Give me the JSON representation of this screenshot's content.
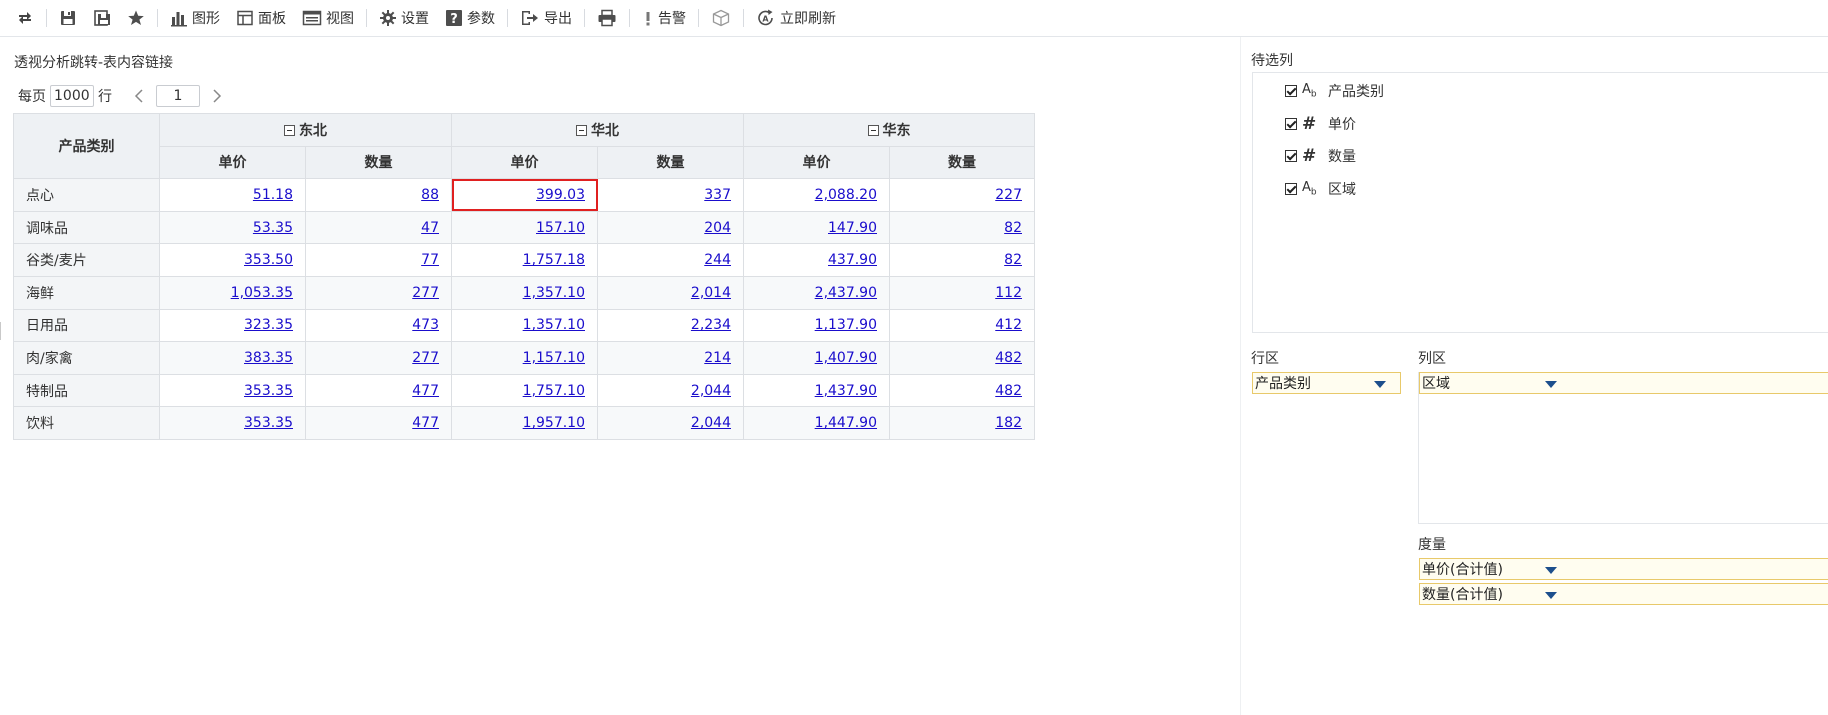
{
  "toolbar": {
    "items": [
      {
        "id": "refresh",
        "icon": "refresh-arrows-icon"
      },
      {
        "id": "save",
        "icon": "save-icon"
      },
      {
        "id": "save-as",
        "icon": "save-as-icon"
      },
      {
        "id": "favorite",
        "icon": "star-icon"
      },
      {
        "id": "chart",
        "icon": "bar-chart-icon",
        "label": "图形"
      },
      {
        "id": "panel",
        "icon": "panel-layout-icon",
        "label": "面板"
      },
      {
        "id": "view",
        "icon": "view-icon",
        "label": "视图"
      },
      {
        "id": "settings",
        "icon": "gear-icon",
        "label": "设置"
      },
      {
        "id": "params",
        "icon": "question-icon",
        "label": "参数"
      },
      {
        "id": "export",
        "icon": "export-icon",
        "label": "导出"
      },
      {
        "id": "print",
        "icon": "printer-icon"
      },
      {
        "id": "alert",
        "icon": "exclamation-icon",
        "label": "告警"
      },
      {
        "id": "cube",
        "icon": "cube-icon"
      },
      {
        "id": "refresh-now",
        "icon": "refresh-now-icon",
        "label": "立即刷新"
      }
    ]
  },
  "report": {
    "title": "透视分析跳转-表内容链接"
  },
  "pager": {
    "prefix": "每页",
    "rows_per_page": "1000",
    "suffix": "行",
    "current_page": "1"
  },
  "table": {
    "row_header": "产品类别",
    "regions": [
      "东北",
      "华北",
      "华东"
    ],
    "measures": [
      "单价",
      "数量"
    ],
    "rows": [
      {
        "category": "点心",
        "values": [
          "51.18",
          "88",
          "399.03",
          "337",
          "2,088.20",
          "227"
        ]
      },
      {
        "category": "调味品",
        "values": [
          "53.35",
          "47",
          "157.10",
          "204",
          "147.90",
          "82"
        ]
      },
      {
        "category": "谷类/麦片",
        "values": [
          "353.50",
          "77",
          "1,757.18",
          "244",
          "437.90",
          "82"
        ]
      },
      {
        "category": "海鲜",
        "values": [
          "1,053.35",
          "277",
          "1,357.10",
          "2,014",
          "2,437.90",
          "112"
        ]
      },
      {
        "category": "日用品",
        "values": [
          "323.35",
          "473",
          "1,357.10",
          "2,234",
          "1,137.90",
          "412"
        ]
      },
      {
        "category": "肉/家禽",
        "values": [
          "383.35",
          "277",
          "1,157.10",
          "214",
          "1,407.90",
          "482"
        ]
      },
      {
        "category": "特制品",
        "values": [
          "353.35",
          "477",
          "1,757.10",
          "2,044",
          "1,437.90",
          "482"
        ]
      },
      {
        "category": "饮料",
        "values": [
          "353.35",
          "477",
          "1,957.10",
          "2,044",
          "1,447.90",
          "182"
        ]
      }
    ],
    "selected_cell": {
      "row": 0,
      "col": 2
    }
  },
  "side_panel": {
    "pending_label": "待选列",
    "pending_items": [
      {
        "type": "text",
        "type_label": "Ab",
        "name": "产品类别",
        "checked": true
      },
      {
        "type": "number",
        "type_label": "#",
        "name": "单价",
        "checked": true
      },
      {
        "type": "number",
        "type_label": "#",
        "name": "数量",
        "checked": true
      },
      {
        "type": "text",
        "type_label": "Ab",
        "name": "区域",
        "checked": true
      }
    ],
    "row_zone_label": "行区",
    "row_zone_items": [
      "产品类别"
    ],
    "col_zone_label": "列区",
    "col_zone_items": [
      "区域"
    ],
    "measure_label": "度量",
    "measure_items": [
      "单价(合计值)",
      "数量(合计值)"
    ]
  },
  "colors": {
    "link": "#1a0dcc",
    "header_bg": "#eef1f4",
    "selected_outline": "#e02020",
    "pill_bg": "#fffdf0",
    "pill_border": "#e8c96a"
  }
}
